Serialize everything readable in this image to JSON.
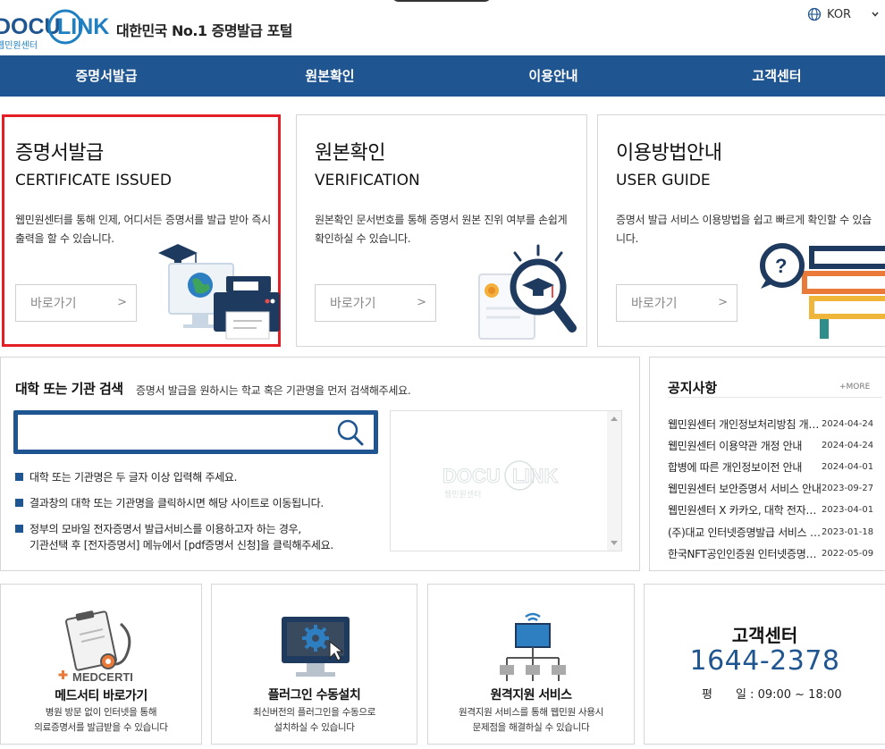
{
  "header": {
    "logo_docu": "DOCU",
    "logo_link": "LINK",
    "logo_sub": "웹민원센터",
    "tagline": "대한민국 No.1 증명발급 포털",
    "language": "KOR"
  },
  "nav": {
    "items": [
      {
        "label": "증명서발급"
      },
      {
        "label": "원본확인"
      },
      {
        "label": "이용안내"
      },
      {
        "label": "고객센터"
      }
    ]
  },
  "cards": [
    {
      "title": "증명서발급",
      "subtitle": "CERTIFICATE ISSUED",
      "desc": "웹민원센터를 통해 인제, 어디서든 증명서를 발급 받아 즉시출력을 할 수 있습니다.",
      "button": "바로가기",
      "arrow": ">"
    },
    {
      "title": "원본확인",
      "subtitle": "VERIFICATION",
      "desc": "원본확인 문서번호를 통해 증명서 원본 진위 여부를 손쉽게 확인하실 수 있습니다.",
      "button": "바로가기",
      "arrow": ">"
    },
    {
      "title": "이용방법안내",
      "subtitle": "USER GUIDE",
      "desc": "증명서 발급 서비스 이용방법을 쉽고 빠르게 확인할 수 있습니다.",
      "button": "바로가기",
      "arrow": ">"
    }
  ],
  "search": {
    "title": "대학 또는 기관 검색",
    "subtitle": "증명서 발급을 원하시는 학교 혹은 기관명을 먼저 검색해주세요.",
    "value": "",
    "bullets": [
      "대학 또는 기관명은 두 글자 이상 입력해 주세요.",
      "결과창의 대학 또는 기관명을 클릭하시면 해당 사이트로 이동됩니다.",
      "정부의 모바일 전자증명서 발급서비스를 이용하고자 하는 경우,",
      "기관선택 후 [전자증명서] 메뉴에서 [pdf증명서 신청]을 클릭해주세요."
    ],
    "watermark_docu": "DOCU",
    "watermark_link": "LINK",
    "watermark_sub": "웹민원센터"
  },
  "notice": {
    "title": "공지사항",
    "more": "+MORE",
    "items": [
      {
        "title": "웹민원센터 개인정보처리방침 개정 안내",
        "date": "2024-04-24"
      },
      {
        "title": "웹민원센터 이용약관 개정 안내",
        "date": "2024-04-24"
      },
      {
        "title": "합병에 따른 개인정보이전 안내",
        "date": "2024-04-01"
      },
      {
        "title": "웹민원센터 보안증명서 서비스 안내",
        "date": "2023-09-27"
      },
      {
        "title": "웹민원센터 X 카카오, 대학 전자증명서 안내",
        "date": "2023-04-01"
      },
      {
        "title": "(주)대교 인터넷증명발급 서비스 안내",
        "date": "2023-01-18"
      },
      {
        "title": "한국NFT공인인증원 인터넷증명발급 안내",
        "date": "2022-05-09"
      }
    ]
  },
  "bottom": [
    {
      "brand": "MEDCERTI",
      "title": "메드서티 바로가기",
      "desc1": "병원 방문 없이 인터넷을 통해",
      "desc2": "의료증명서를 발급받을 수 있습니다"
    },
    {
      "title": "플러그인 수동설치",
      "desc1": "최신버전의 플러그인을 수동으로",
      "desc2": "설치하실 수 있습니다"
    },
    {
      "title": "원격지원 서비스",
      "desc1": "원격지원 서비스를 통해 웹민원 사용시",
      "desc2": "문제점을 해결하실 수 있습니다"
    }
  ],
  "customer": {
    "title": "고객센터",
    "phone": "1644-2378",
    "hours_label": "평　　일 : 09:00 ~ 18:00"
  },
  "colors": {
    "brand_blue": "#1f5590",
    "active_red": "#e31e24"
  }
}
